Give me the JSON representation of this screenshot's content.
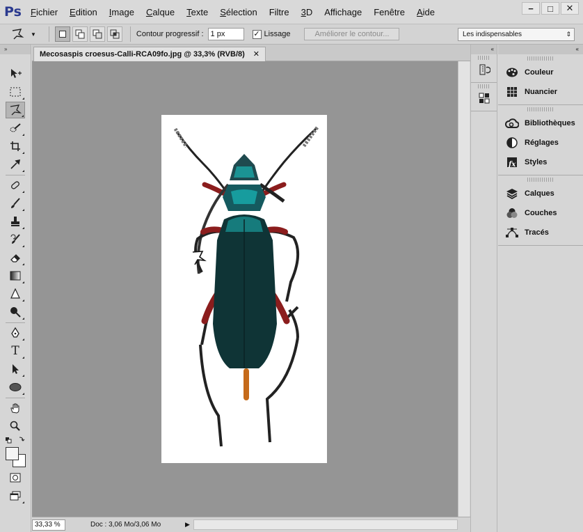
{
  "app": {
    "logo": "Ps"
  },
  "menu": [
    {
      "label": "Fichier",
      "ul": "F",
      "rest": "ichier"
    },
    {
      "label": "Edition",
      "ul": "E",
      "rest": "dition"
    },
    {
      "label": "Image",
      "ul": "I",
      "rest": "mage"
    },
    {
      "label": "Calque",
      "ul": "C",
      "rest": "alque"
    },
    {
      "label": "Texte",
      "ul": "T",
      "rest": "exte"
    },
    {
      "label": "Sélection",
      "ul": "S",
      "rest": "élection"
    },
    {
      "label": "Filtre",
      "ul": "",
      "rest": "Filtre"
    },
    {
      "label": "3D",
      "ul": "3",
      "rest": "D"
    },
    {
      "label": "Affichage",
      "ul": "",
      "rest": "Affichage"
    },
    {
      "label": "Fenêtre",
      "ul": "",
      "rest": "Fenêtre"
    },
    {
      "label": "Aide",
      "ul": "A",
      "rest": "ide"
    }
  ],
  "window_controls": {
    "minimize": "−",
    "restore": "□",
    "close": "✕"
  },
  "options": {
    "feather_label": "Contour progressif :",
    "feather_value": "1 px",
    "smoothing_label": "Lissage",
    "smoothing_checked": "✓",
    "refine_edge": "Améliorer le contour...",
    "workspace": "Les indispensables",
    "workspace_arrow": "⇕"
  },
  "document": {
    "tab_title": "Mecosaspis croesus-Calli-RCA09fo.jpg @ 33,3% (RVB/8)",
    "tab_close": "✕"
  },
  "status": {
    "zoom": "33,33 %",
    "doc_info": "Doc : 3,06 Mo/3,06 Mo",
    "arrow": "▶"
  },
  "panels": {
    "group1": [
      "Couleur",
      "Nuancier"
    ],
    "group2": [
      "Bibliothèques",
      "Réglages",
      "Styles"
    ],
    "group3": [
      "Calques",
      "Couches",
      "Tracés"
    ]
  },
  "collapse_arrows": {
    "left": "»",
    "mid": "«",
    "right": "«"
  }
}
